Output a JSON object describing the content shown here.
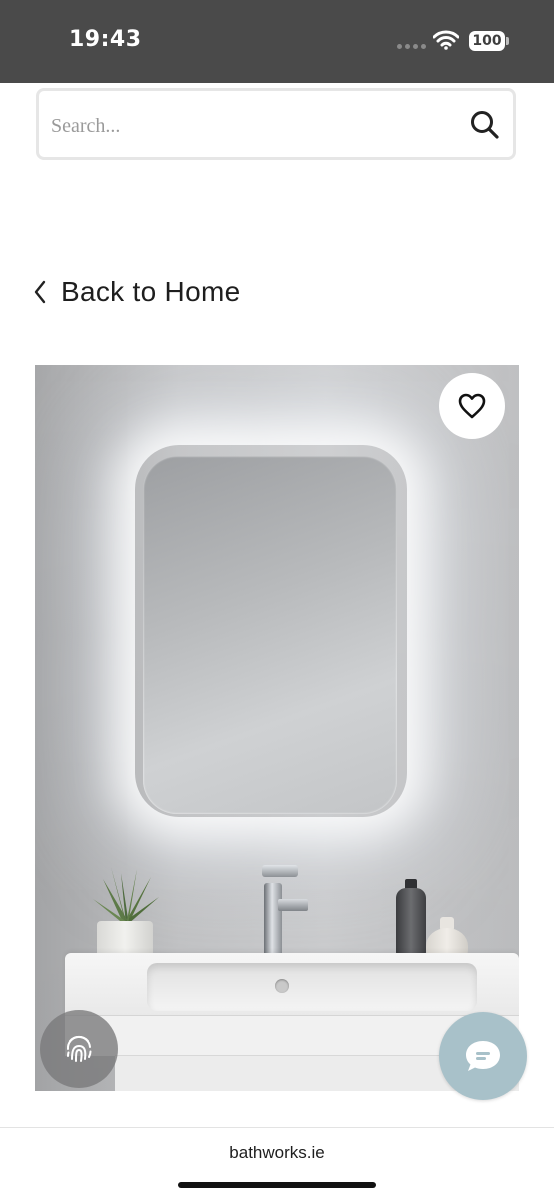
{
  "status_bar": {
    "time": "19:43",
    "battery": "100"
  },
  "search": {
    "placeholder": "Search..."
  },
  "nav": {
    "back_label": "Back to Home"
  },
  "browser": {
    "url": "bathworks.ie"
  },
  "colors": {
    "status_bar_bg": "#4a4a4a",
    "chat_button": "#a8c1c9",
    "search_border": "#e6e6e6"
  },
  "icons": [
    "wifi-icon",
    "search-icon",
    "chevron-left-icon",
    "heart-icon",
    "fingerprint-icon",
    "chat-icon"
  ]
}
